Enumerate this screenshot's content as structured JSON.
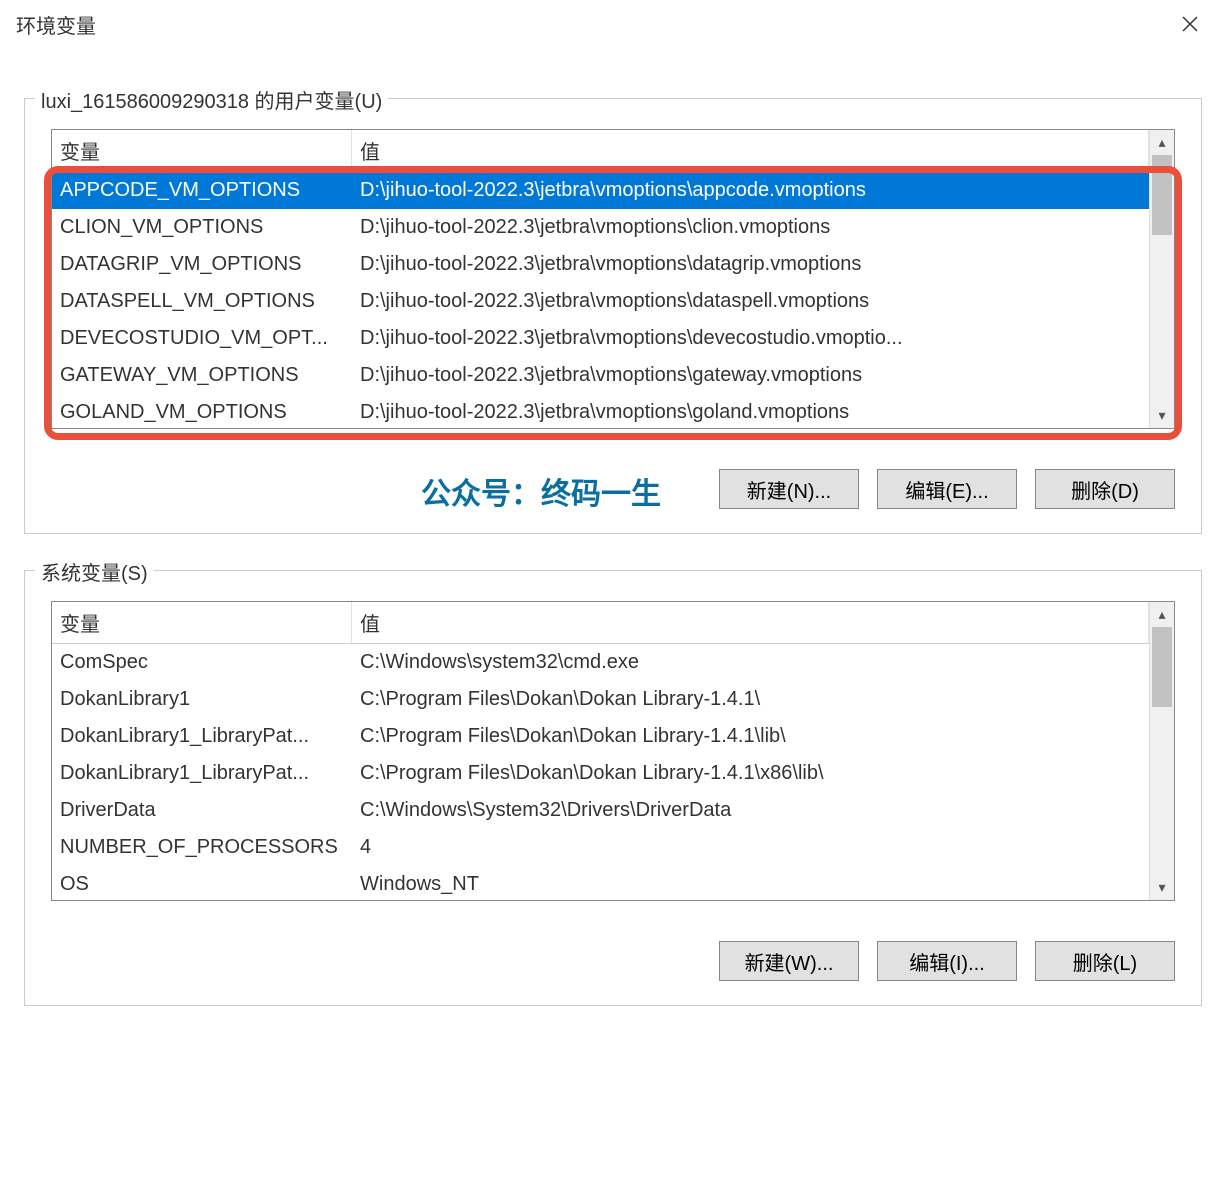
{
  "window": {
    "title": "环境变量"
  },
  "user_section": {
    "label": "luxi_161586009290318 的用户变量(U)",
    "columns": {
      "var": "变量",
      "val": "值"
    },
    "rows": [
      {
        "var": "APPCODE_VM_OPTIONS",
        "val": "D:\\jihuo-tool-2022.3\\jetbra\\vmoptions\\appcode.vmoptions",
        "selected": true
      },
      {
        "var": "CLION_VM_OPTIONS",
        "val": "D:\\jihuo-tool-2022.3\\jetbra\\vmoptions\\clion.vmoptions"
      },
      {
        "var": "DATAGRIP_VM_OPTIONS",
        "val": "D:\\jihuo-tool-2022.3\\jetbra\\vmoptions\\datagrip.vmoptions"
      },
      {
        "var": "DATASPELL_VM_OPTIONS",
        "val": "D:\\jihuo-tool-2022.3\\jetbra\\vmoptions\\dataspell.vmoptions"
      },
      {
        "var": "DEVECOSTUDIO_VM_OPT...",
        "val": "D:\\jihuo-tool-2022.3\\jetbra\\vmoptions\\devecostudio.vmoptio..."
      },
      {
        "var": "GATEWAY_VM_OPTIONS",
        "val": "D:\\jihuo-tool-2022.3\\jetbra\\vmoptions\\gateway.vmoptions"
      },
      {
        "var": "GOLAND_VM_OPTIONS",
        "val": "D:\\jihuo-tool-2022.3\\jetbra\\vmoptions\\goland.vmoptions"
      }
    ],
    "buttons": {
      "new": "新建(N)...",
      "edit": "编辑(E)...",
      "delete": "删除(D)"
    }
  },
  "watermark": "公众号：终码一生",
  "system_section": {
    "label": "系统变量(S)",
    "columns": {
      "var": "变量",
      "val": "值"
    },
    "rows": [
      {
        "var": "ComSpec",
        "val": "C:\\Windows\\system32\\cmd.exe"
      },
      {
        "var": "DokanLibrary1",
        "val": "C:\\Program Files\\Dokan\\Dokan Library-1.4.1\\"
      },
      {
        "var": "DokanLibrary1_LibraryPat...",
        "val": "C:\\Program Files\\Dokan\\Dokan Library-1.4.1\\lib\\"
      },
      {
        "var": "DokanLibrary1_LibraryPat...",
        "val": "C:\\Program Files\\Dokan\\Dokan Library-1.4.1\\x86\\lib\\"
      },
      {
        "var": "DriverData",
        "val": "C:\\Windows\\System32\\Drivers\\DriverData"
      },
      {
        "var": "NUMBER_OF_PROCESSORS",
        "val": "4"
      },
      {
        "var": "OS",
        "val": "Windows_NT"
      }
    ],
    "buttons": {
      "new": "新建(W)...",
      "edit": "编辑(I)...",
      "delete": "删除(L)"
    }
  }
}
